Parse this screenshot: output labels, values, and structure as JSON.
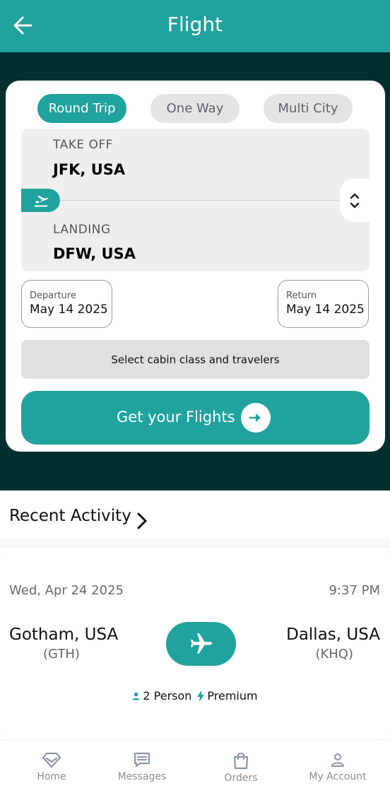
{
  "header": {
    "title": "Flight"
  },
  "search": {
    "trip_types": [
      "Round Trip",
      "One Way",
      "Multi City"
    ],
    "active_trip_type": "Round Trip",
    "takeoff": {
      "label": "TAKE OFF",
      "value": "JFK, USA"
    },
    "landing": {
      "label": "LANDING",
      "value": "DFW, USA"
    },
    "departure": {
      "label": "Departure",
      "value": "May 14 2025"
    },
    "return": {
      "label": "Return",
      "value": "May 14 2025"
    },
    "cabin_label": "Select cabin class and travelers",
    "submit_label": "Get your Flights"
  },
  "recent": {
    "title": "Recent Activity",
    "item": {
      "date": "Wed, Apr 24 2025",
      "time": "9:37 PM",
      "from_city": "Gotham, USA",
      "from_code": "(GTH)",
      "to_city": "Dallas, USA",
      "to_code": "(KHQ)",
      "travelers": "2 Person",
      "cabin": "Premium"
    }
  },
  "nav": {
    "items": [
      {
        "label": "Home",
        "icon": "home-icon"
      },
      {
        "label": "Messages",
        "icon": "messages-icon"
      },
      {
        "label": "Orders",
        "icon": "bag-icon"
      },
      {
        "label": "My Account",
        "icon": "user-icon"
      }
    ]
  },
  "colors": {
    "accent": "#20a39e",
    "dark": "#012f2f"
  }
}
